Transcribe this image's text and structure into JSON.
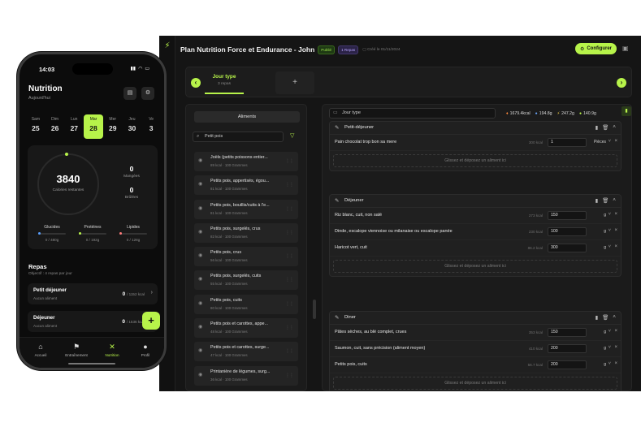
{
  "desktop": {
    "title": "Plan Nutrition Force et Endurance - John",
    "badge_published": "Publié",
    "badge_meals": "1 Repas",
    "created": "Créé le 01/11/2024",
    "config_label": "Configurer",
    "day_tab": {
      "label": "Jour type",
      "sub": "3 repas"
    },
    "add_day": "+",
    "left_panel": {
      "tab_label": "Aliments",
      "search_value": "Petit pois",
      "foods": [
        {
          "name": "Joëls (petits poissons entier...",
          "sub": "89 kcal · 100 Grammes"
        },
        {
          "name": "Petits pois, appertisés, égou...",
          "sub": "81 kcal · 100 Grammes"
        },
        {
          "name": "Petits pois, bouillis/cuits à l'e...",
          "sub": "81 kcal · 100 Grammes"
        },
        {
          "name": "Petits pois, surgelés, crus",
          "sub": "82 kcal · 100 Grammes"
        },
        {
          "name": "Petits pois, crus",
          "sub": "56 kcal · 100 Grammes"
        },
        {
          "name": "Petits pois, surgelés, cuits",
          "sub": "55 kcal · 100 Grammes"
        },
        {
          "name": "Petits pois, cuits",
          "sub": "80 kcal · 100 Grammes"
        },
        {
          "name": "Petits pois et carottes, appe...",
          "sub": "48 kcal · 100 Grammes"
        },
        {
          "name": "Petits pois et carottes, surge...",
          "sub": "47 kcal · 100 Grammes"
        },
        {
          "name": "Printanière de légumes, surg...",
          "sub": "36 kcal · 100 Grammes"
        }
      ]
    },
    "right_panel": {
      "day_type_value": "Jour type",
      "macros": {
        "kcal": "1679.4kcal",
        "protein": "194.8g",
        "carbs": "247.2g",
        "fat": "140.9g"
      },
      "dropzone_label": "Glissez et déposez un aliment ici",
      "meals": [
        {
          "name": "Petit-déjeuner",
          "items": [
            {
              "name": "Pain chocolat trop bon sa mere",
              "kcal": "300 kcal",
              "qty": "1",
              "unit": "Pièces"
            }
          ]
        },
        {
          "name": "Déjeuner",
          "items": [
            {
              "name": "Riz blanc, cuit, non salé",
              "kcal": "273 kcal",
              "qty": "150",
              "unit": "g"
            },
            {
              "name": "Dinde, escalope viennoise ou milanaise ou escalope panée",
              "kcal": "230 kcal",
              "qty": "100",
              "unit": "g"
            },
            {
              "name": "Haricot vert, cuit",
              "kcal": "86.2 kcal",
              "qty": "300",
              "unit": "g"
            }
          ]
        },
        {
          "name": "Diner",
          "items": [
            {
              "name": "Pâtes sèches, au blé complet, crues",
              "kcal": "353 kcal",
              "qty": "150",
              "unit": "g"
            },
            {
              "name": "Saumon, cuit, sans précision (aliment moyen)",
              "kcal": "410 kcal",
              "qty": "200",
              "unit": "g"
            },
            {
              "name": "Petits pois, cuits",
              "kcal": "56.7 kcal",
              "qty": "200",
              "unit": "g"
            }
          ]
        }
      ]
    }
  },
  "phone": {
    "time": "14:03",
    "title": "Nutrition",
    "subtitle": "Aujourd'hui",
    "days": [
      {
        "name": "Sam",
        "num": "25"
      },
      {
        "name": "Dim",
        "num": "26"
      },
      {
        "name": "Lun",
        "num": "27"
      },
      {
        "name": "Mar",
        "num": "28"
      },
      {
        "name": "Mer",
        "num": "29"
      },
      {
        "name": "Jeu",
        "num": "30"
      },
      {
        "name": "Ve",
        "num": "3"
      }
    ],
    "calories_remaining": "3840",
    "calories_label": "Calories restantes",
    "eaten_value": "0",
    "eaten_label": "Mangées",
    "burned_value": "0",
    "burned_label": "Brûlées",
    "macros": [
      {
        "name": "Glucides",
        "value": "0 / 480g",
        "color": "#5aa0ff"
      },
      {
        "name": "Protéines",
        "value": "0 / 192g",
        "color": "#b7f34a"
      },
      {
        "name": "Lipides",
        "value": "0 / 128g",
        "color": "#ff7a7a"
      }
    ],
    "meals_title": "Repas",
    "meals_subtitle": "Objectif : 4 repas par jour",
    "meals": [
      {
        "name": "Petit déjeuner",
        "sub": "Aucun aliment",
        "kcal": "0",
        "target": "/ 1152 kcal"
      },
      {
        "name": "Déjeuner",
        "sub": "Aucun aliment",
        "kcal": "0",
        "target": "/ 1536 kcal"
      }
    ],
    "nav": [
      {
        "label": "Accueil"
      },
      {
        "label": "Entraînement"
      },
      {
        "label": "Nutrition"
      },
      {
        "label": "Profil"
      }
    ]
  },
  "colors": {
    "accent": "#b7f34a",
    "background": "#151515"
  }
}
